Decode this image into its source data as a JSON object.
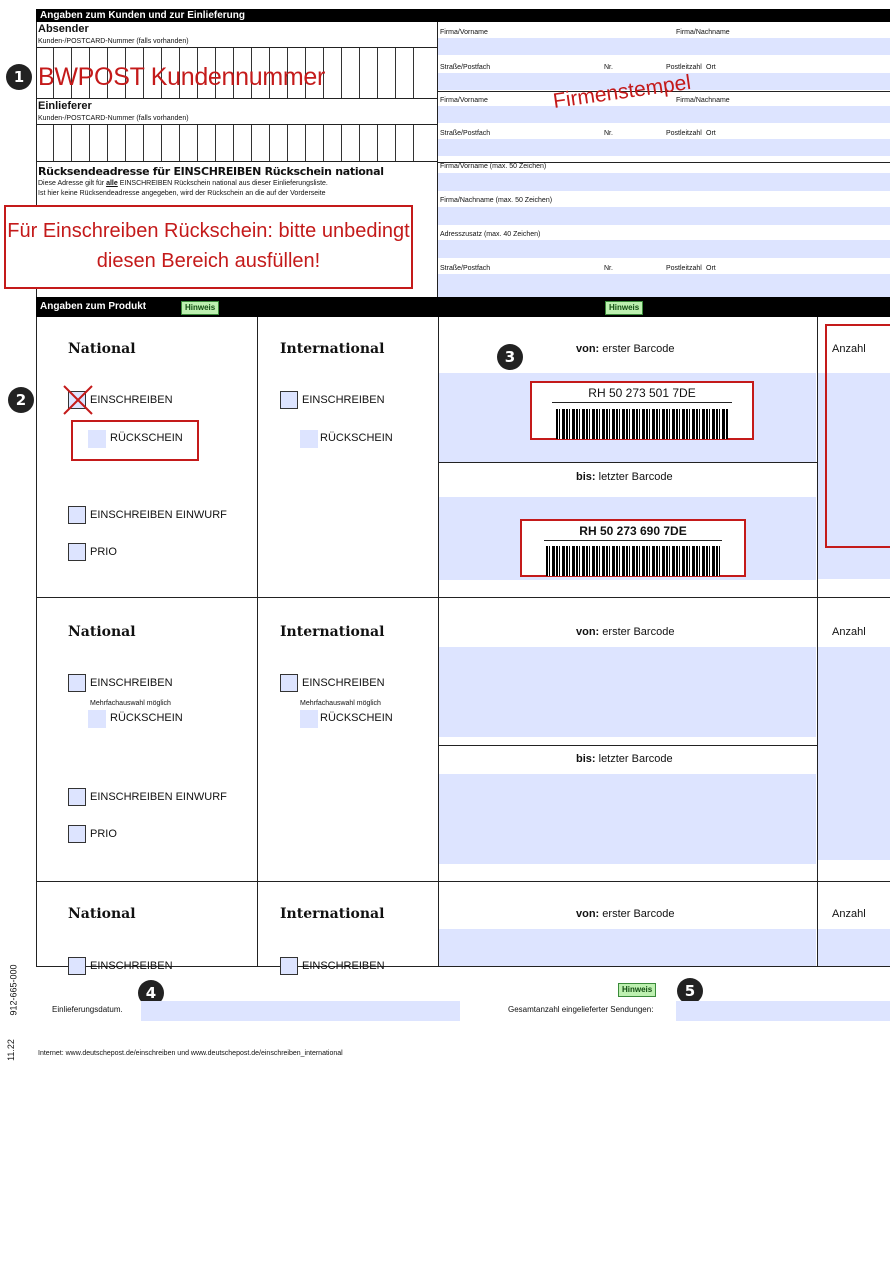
{
  "header": {
    "title": "Angaben zum Kunden und zur Einlieferung"
  },
  "absender": {
    "title": "Absender",
    "customer_label": "Kunden-/POSTCARD-Nummer (falls vorhanden)",
    "annotation": "BWPOST Kundennummer"
  },
  "einlieferer": {
    "title": "Einlieferer",
    "customer_label": "Kunden-/POSTCARD-Nummer (falls vorhanden)"
  },
  "address": {
    "firma_vorname": "Firma/Vorname",
    "firma_nachname": "Firma/Nachname",
    "strasse": "Straße/Postfach",
    "nr": "Nr.",
    "plz": "Postleitzahl",
    "ort": "Ort",
    "stamp": "Firmenstempel"
  },
  "ruecksende": {
    "title": "Rücksendeadresse für EINSCHREIBEN Rückschein national",
    "desc1_pre": "Diese Adresse gilt für ",
    "desc1_u": "alle",
    "desc1_post": " EINSCHREIBEN Rückschein national aus dieser Einlieferungsliste.",
    "desc2": "Ist hier keine Rücksendeadresse angegeben, wird der Rückschein an die auf der Vorderseite",
    "vorname": "Firma/Vorname (max. 50 Zeichen)",
    "nachname": "Firma/Nachname (max. 50 Zeichen)",
    "zusatz": "Adresszusatz (max. 40 Zeichen)",
    "strasse": "Straße/Postfach",
    "nr": "Nr.",
    "plz": "Postleitzahl",
    "ort": "Ort",
    "note": "Für Einschreiben Rückschein: bitte unbedingt diesen Bereich ausfüllen!"
  },
  "produkt": {
    "title": "Angaben zum Produkt",
    "hinweis": "Hinweis"
  },
  "sections": {
    "national": "National",
    "international": "International",
    "einschreiben": "EINSCHREIBEN",
    "rueckschein": "RÜCKSCHEIN",
    "einwurf": "EINSCHREIBEN EINWURF",
    "prio": "PRIO",
    "mehrfach": "Mehrfachauswahl möglich",
    "von_b": "von:",
    "von_t": " erster Barcode",
    "bis_b": "bis:",
    "bis_t": " letzter Barcode",
    "anzahl": "Anzahl"
  },
  "barcodes": {
    "first": "RH 50 273 501 7DE",
    "last": "RH 50 273 690 7DE"
  },
  "markers": [
    "1",
    "2",
    "3",
    "4",
    "5"
  ],
  "footer": {
    "datum": "Einlieferungsdatum.",
    "gesamt": "Gesamtanzahl eingelieferter Sendungen:",
    "hinweis": "Hinweis",
    "internet": "Internet: www.deutschepost.de/einschreiben und www.deutschepost.de/einschreiben_international",
    "side_code": "912-665-000",
    "side_date": "11.22"
  }
}
